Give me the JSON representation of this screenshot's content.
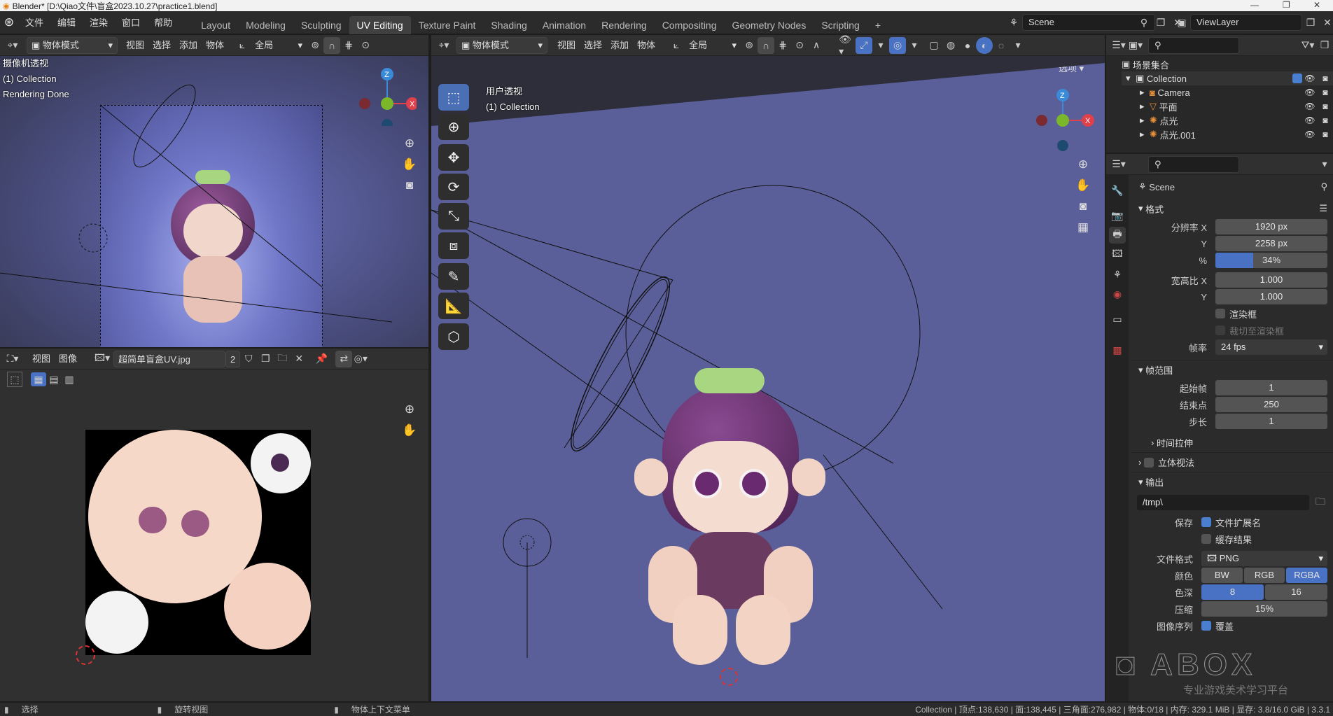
{
  "window": {
    "title": "Blender* [D:\\Qiao文件\\盲盒2023.10.27\\practice1.blend]"
  },
  "topbar": {
    "menus": [
      "文件",
      "编辑",
      "渲染",
      "窗口",
      "帮助"
    ],
    "workspaces": [
      "Layout",
      "Modeling",
      "Sculpting",
      "UV Editing",
      "Texture Paint",
      "Shading",
      "Animation",
      "Rendering",
      "Compositing",
      "Geometry Nodes",
      "Scripting"
    ],
    "active_workspace": "UV Editing",
    "add_tab": "+",
    "scene_label": "Scene",
    "viewlayer_label": "ViewLayer"
  },
  "left_viewport": {
    "mode": "物体模式",
    "menus": [
      "视图",
      "选择",
      "添加",
      "物体"
    ],
    "transform": "全局",
    "overlay_lines": [
      "摄像机透视",
      "(1) Collection",
      "Rendering Done"
    ]
  },
  "uv_editor": {
    "menus": [
      "视图",
      "图像"
    ],
    "image_name": "超简单盲盒UV.jpg",
    "users_count": "2"
  },
  "main_viewport": {
    "mode": "物体模式",
    "menus": [
      "视图",
      "选择",
      "添加",
      "物体"
    ],
    "transform": "全局",
    "options_label": "选项",
    "overlay_lines": [
      "用户透视",
      "(1) Collection"
    ]
  },
  "outliner": {
    "root": "场景集合",
    "items": [
      {
        "label": "Collection",
        "icon": "collection-icon"
      },
      {
        "label": "Camera",
        "icon": "camera-icon"
      },
      {
        "label": "平面",
        "icon": "mesh-icon"
      },
      {
        "label": "点光",
        "icon": "light-icon"
      },
      {
        "label": "点光.001",
        "icon": "light-icon"
      }
    ]
  },
  "properties": {
    "scene_name": "Scene",
    "format_section": "格式",
    "res_x_label": "分辨率 X",
    "res_x": "1920 px",
    "res_y_label": "Y",
    "res_y": "2258 px",
    "res_pct_label": "%",
    "res_pct": "34%",
    "res_pct_fraction": 0.34,
    "aspect_x_label": "宽高比 X",
    "aspect_x": "1.000",
    "aspect_y_label": "Y",
    "aspect_y": "1.000",
    "render_region": "渲染框",
    "crop_region": "裁切至渲染框",
    "fps_label": "帧率",
    "fps": "24 fps",
    "frame_range_section": "帧范围",
    "frame_start_label": "起始帧",
    "frame_start": "1",
    "frame_end_label": "结束点",
    "frame_end": "250",
    "frame_step_label": "步长",
    "frame_step": "1",
    "time_stretch": "时间拉伸",
    "stereoscopy": "立体视法",
    "output_section": "输出",
    "output_path": "/tmp\\",
    "save_label": "保存",
    "file_ext": "文件扩展名",
    "cache_result": "缓存结果",
    "file_format_label": "文件格式",
    "file_format": "PNG",
    "color_label": "颜色",
    "color_options": [
      "BW",
      "RGB",
      "RGBA"
    ],
    "color_selected": "RGBA",
    "depth_label": "色深",
    "depth_options": [
      "8",
      "16"
    ],
    "depth_selected": "8",
    "compression_label": "压缩",
    "compression": "15%",
    "image_seq_label": "图像序列",
    "overwrite": "覆盖"
  },
  "statusbar": {
    "left1": "选择",
    "left2": "旋转视图",
    "left3": "物体上下文菜单",
    "stats": "Collection | 顶点:138,630 | 面:138,445 | 三角面:276,982 | 物体:0/18 | 内存: 329.1 MiB | 显存: 3.8/16.0 GiB | 3.3.1"
  },
  "watermark": "专业游戏美术学习平台",
  "colors": {
    "accent": "#4a72c4",
    "viewport_bg": "#5a5f9a",
    "x_axis": "#e0404a",
    "y_axis": "#7ab82a",
    "z_axis": "#3a8ad8"
  }
}
